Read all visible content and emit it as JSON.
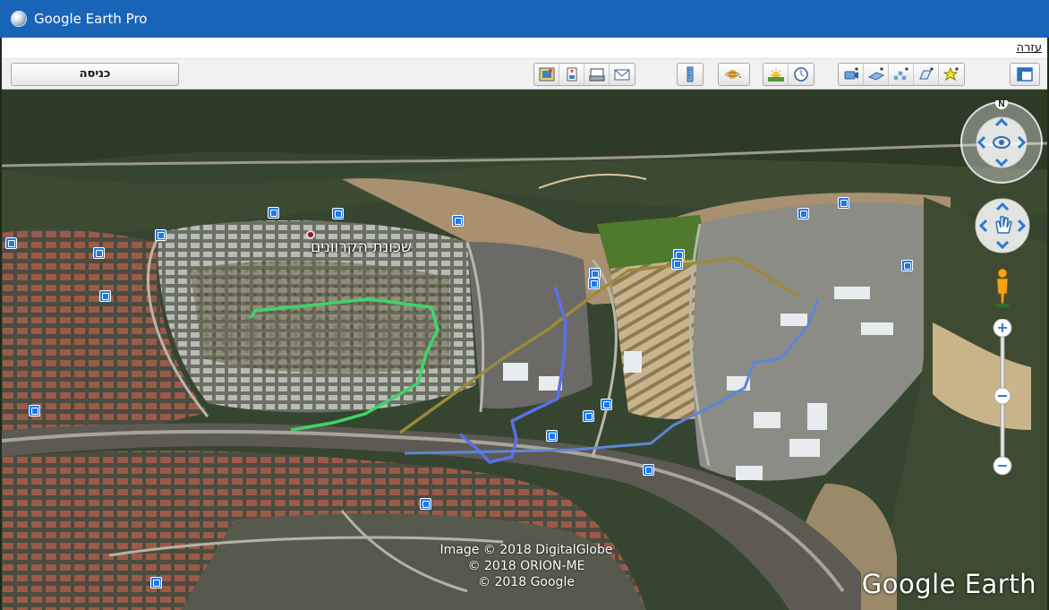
{
  "window": {
    "title": "Google Earth Pro"
  },
  "menu": {
    "help": "עזרה"
  },
  "toolbar": {
    "signin_label": "כניסה",
    "buttons": [
      "save-image-icon",
      "print-icon",
      "map-icon",
      "email-icon",
      "ruler-icon",
      "planet-icon",
      "sunlight-icon",
      "historical-imagery-icon",
      "record-tour-icon",
      "add-image-overlay-icon",
      "add-path-icon",
      "add-polygon-icon",
      "add-placemark-icon",
      "sidebar-toggle-icon"
    ]
  },
  "map": {
    "place_label": "שכונת הקרוונים",
    "credits": [
      "Image © 2018 DigitalGlobe",
      "© 2018 ORION-ME",
      "© 2018 Google"
    ],
    "watermark": "Google Earth",
    "compass_north": "N",
    "zoom_in": "+",
    "zoom_out": "−",
    "path_colors": {
      "green": "#3fd46a",
      "gold": "#9a8a3a",
      "blue_dark": "#5b6fe6",
      "blue_light": "#5d86d8"
    }
  }
}
